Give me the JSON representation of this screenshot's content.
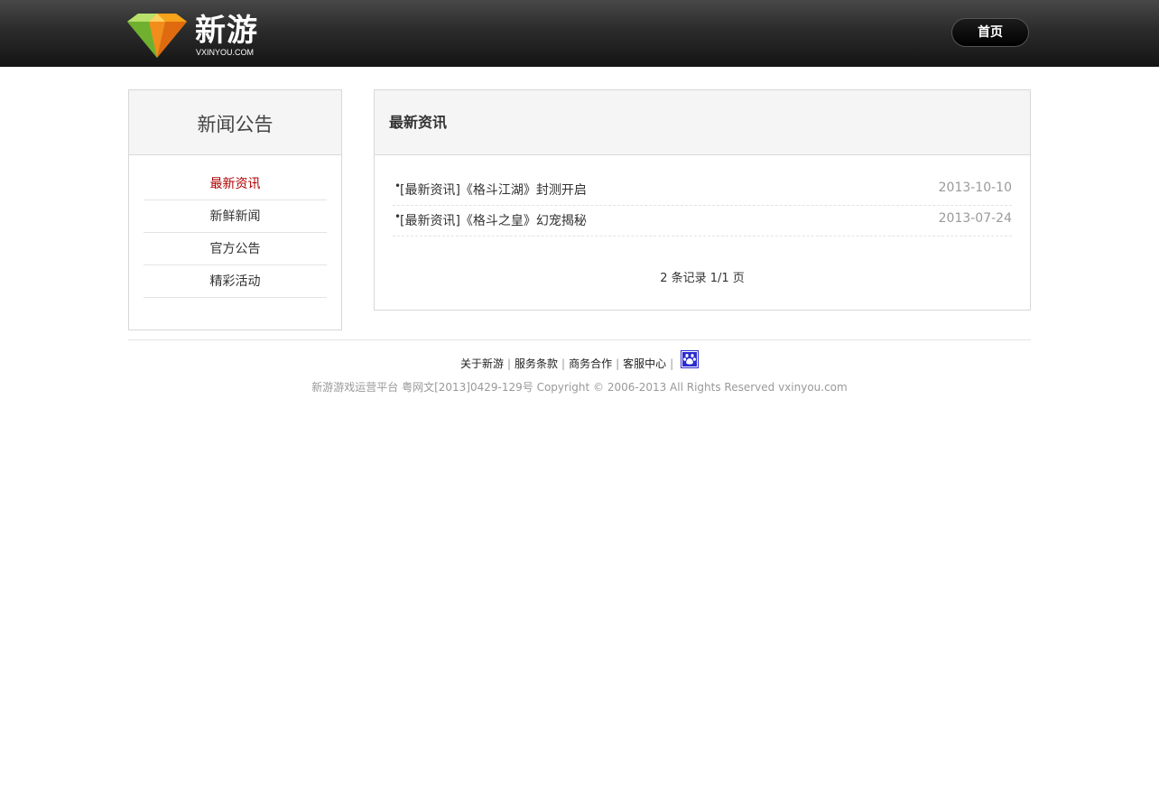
{
  "header": {
    "logo_text": "新游",
    "logo_sub": "VXINYOU.COM",
    "home_button": "首页"
  },
  "sidebar": {
    "title": "新闻公告",
    "items": [
      {
        "label": "最新资讯",
        "active": true
      },
      {
        "label": "新鲜新闻",
        "active": false
      },
      {
        "label": "官方公告",
        "active": false
      },
      {
        "label": "精彩活动",
        "active": false
      }
    ]
  },
  "main": {
    "title": "最新资讯",
    "news": [
      {
        "title": "[最新资讯]《格斗江湖》封测开启",
        "date": "2013-10-10"
      },
      {
        "title": "[最新资讯]《格斗之皇》幻宠揭秘",
        "date": "2013-07-24"
      }
    ],
    "pager": "2 条记录 1/1 页"
  },
  "footer": {
    "links": [
      "关于新游",
      "服务条款",
      "商务合作",
      "客服中心"
    ],
    "separator": "|",
    "copyright": "新游游戏运营平台 粤网文[2013]0429-129号 Copyright © 2006-2013 All Rights Reserved vxinyou.com"
  },
  "colors": {
    "accent_active": "#b00000",
    "topbar": "#1f1f1f",
    "paw_icon_bg": "#2b2bd0"
  }
}
